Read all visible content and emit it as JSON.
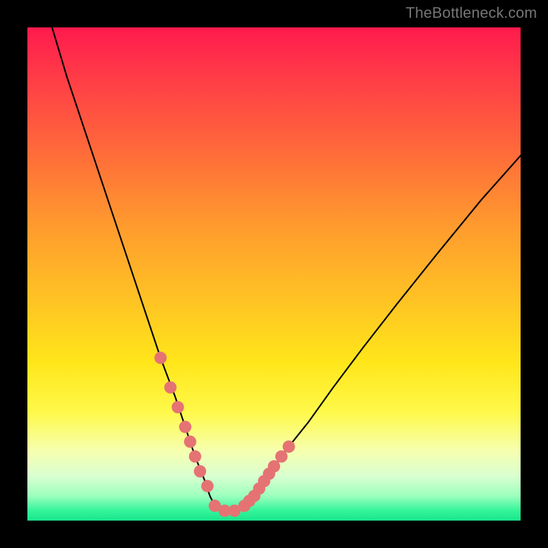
{
  "watermark": "TheBottleneck.com",
  "colors": {
    "frame": "#000000",
    "curve": "#000000",
    "marker_fill": "#e57373",
    "marker_stroke": "#c95f5f"
  },
  "chart_data": {
    "type": "line",
    "title": "",
    "xlabel": "",
    "ylabel": "",
    "xlim": [
      0,
      100
    ],
    "ylim": [
      0,
      100
    ],
    "grid": false,
    "series": [
      {
        "name": "bottleneck-curve",
        "x": [
          5,
          8,
          12,
          16,
          20,
          24,
          27,
          30,
          32,
          34,
          36,
          37,
          38,
          39,
          40,
          42,
          44,
          46,
          48,
          50,
          53,
          57,
          62,
          68,
          75,
          83,
          92,
          100
        ],
        "y": [
          100,
          90,
          78,
          66,
          54,
          42,
          33,
          25,
          19,
          13,
          8,
          5,
          3,
          2,
          2,
          2,
          3,
          5,
          8,
          11,
          15,
          20,
          27,
          35,
          44,
          54,
          65,
          74
        ]
      }
    ],
    "markers": {
      "name": "highlighted-points",
      "x": [
        27,
        29,
        30.5,
        32,
        33,
        34,
        35,
        36.5,
        38,
        40,
        42,
        44,
        45,
        46,
        47,
        48,
        49,
        50,
        51.5,
        53
      ],
      "y": [
        33,
        27,
        23,
        19,
        16,
        13,
        10,
        7,
        3,
        2,
        2,
        3,
        4,
        5,
        6.5,
        8,
        9.5,
        11,
        13,
        15
      ]
    }
  }
}
